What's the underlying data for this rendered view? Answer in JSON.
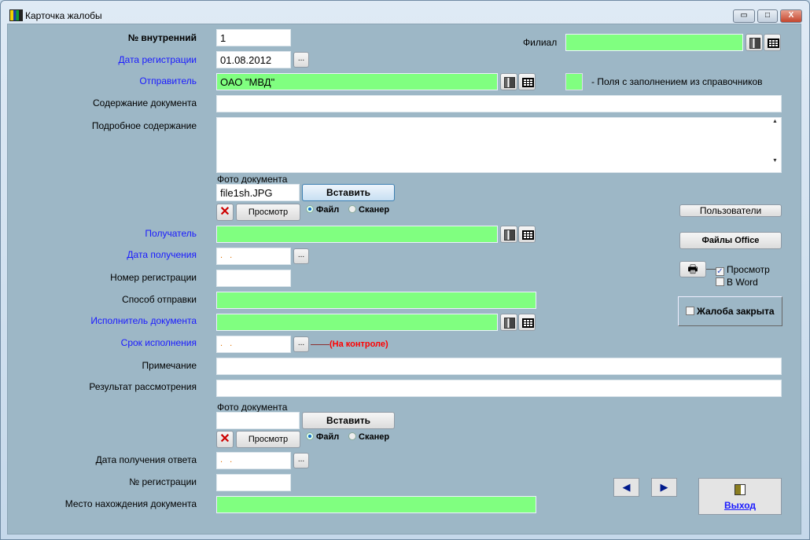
{
  "window": {
    "title": "Карточка жалобы",
    "minimize": "▭",
    "maximize": "□",
    "close": "X"
  },
  "fields": {
    "internal_no": {
      "label": "№ внутренний",
      "value": "1"
    },
    "reg_date": {
      "label": "Дата регистрации",
      "value": "01.08.2012"
    },
    "sender": {
      "label": "Отправитель",
      "value": "ОАО \"МВД\""
    },
    "content": {
      "label": "Содержание документа",
      "value": ""
    },
    "details": {
      "label": "Подробное содержание",
      "value": ""
    },
    "branch": {
      "label": "Филиал",
      "value": ""
    },
    "legend": "-  Поля с заполнением из справочников",
    "photo1": {
      "label": "Фото документа",
      "value": "file1sh.JPG",
      "insert": "Вставить",
      "view": "Просмотр",
      "file": "Файл",
      "scanner": "Сканер"
    },
    "recipient": {
      "label": "Получатель",
      "value": ""
    },
    "recv_date": {
      "label": "Дата получения",
      "value": " .  ."
    },
    "reg_number": {
      "label": "Номер регистрации",
      "value": ""
    },
    "send_method": {
      "label": "Способ отправки",
      "value": ""
    },
    "executor": {
      "label": "Исполнитель документа",
      "value": ""
    },
    "deadline": {
      "label": "Срок исполнения",
      "value": " .  .",
      "control": "(На контроле)"
    },
    "note": {
      "label": "Примечание",
      "value": ""
    },
    "result": {
      "label": "Результат рассмотрения",
      "value": ""
    },
    "photo2": {
      "label": "Фото документа",
      "value": "",
      "insert": "Вставить",
      "view": "Просмотр",
      "file": "Файл",
      "scanner": "Сканер"
    },
    "answer_date": {
      "label": "Дата получения ответа",
      "value": " .  ."
    },
    "reg_no2": {
      "label": "№ регистрации",
      "value": ""
    },
    "location": {
      "label": "Место нахождения документа",
      "value": ""
    }
  },
  "side": {
    "users": "Пользователи",
    "office": "Файлы Office",
    "preview": "Просмотр",
    "preview_checked": true,
    "word": "В Word",
    "word_checked": false,
    "closed": "Жалоба закрыта",
    "closed_checked": false,
    "exit": "Выход"
  },
  "ellipsis": "...",
  "colors": {
    "lookup": "#80ff80",
    "bg": "#9db7c6",
    "link": "#1a1aff",
    "warn": "#ff0000"
  }
}
